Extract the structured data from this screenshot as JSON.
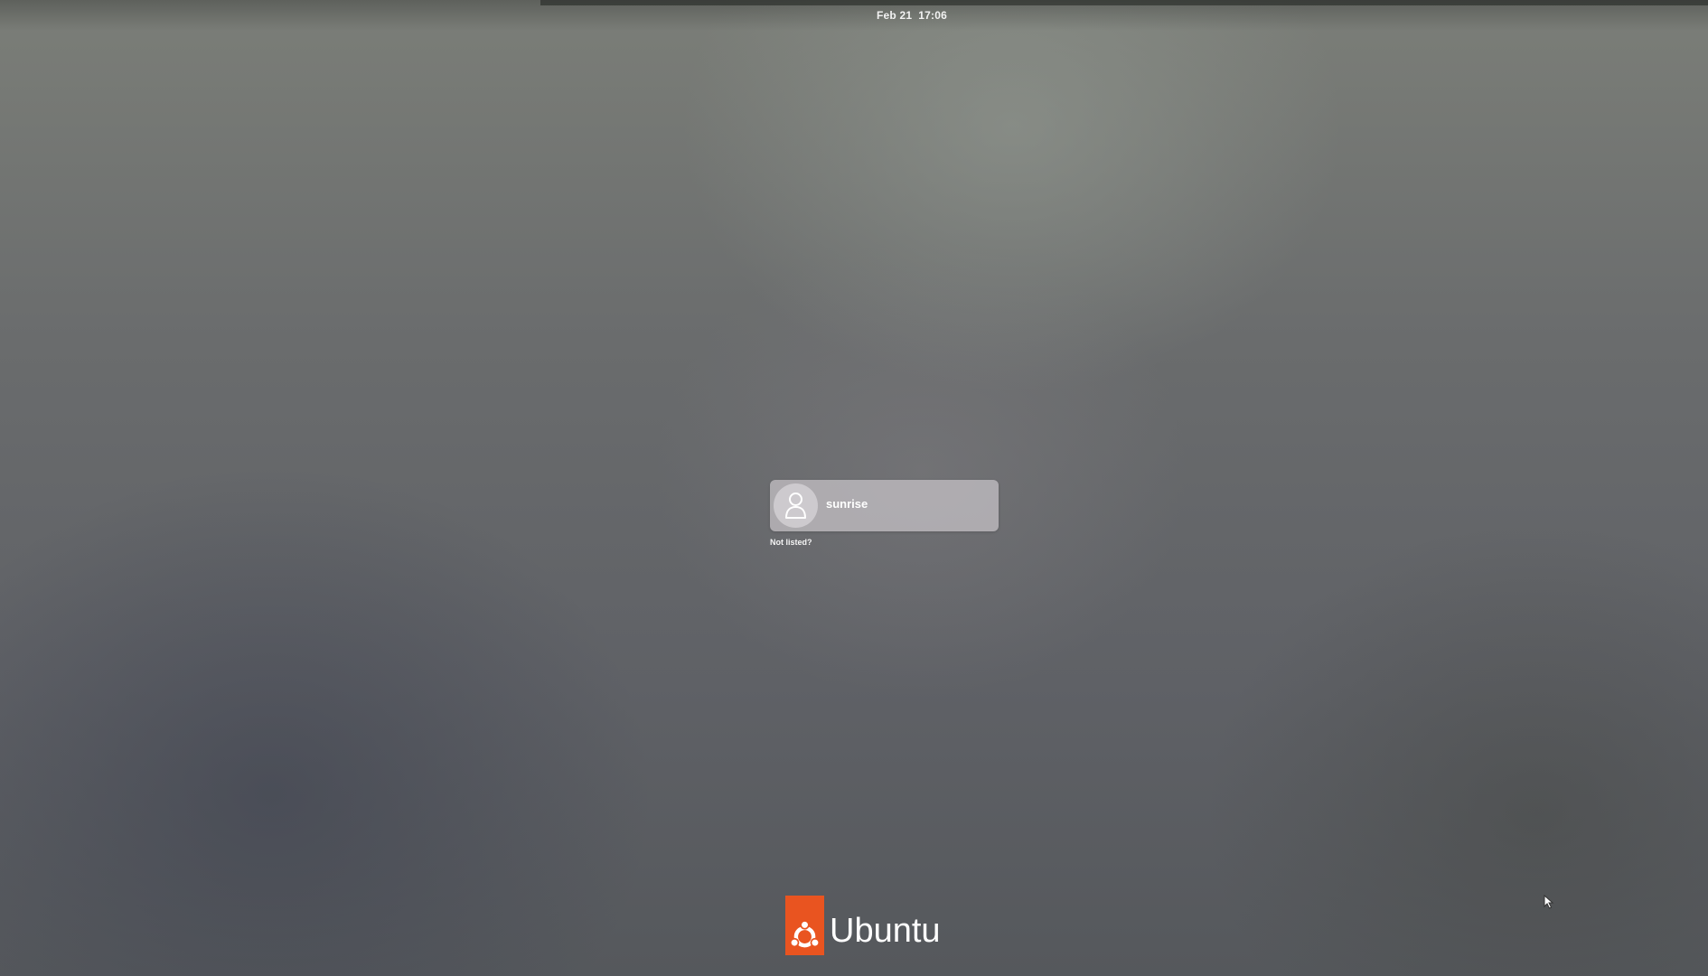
{
  "top_bar": {
    "clock": "Feb 21  17:06"
  },
  "login": {
    "users": [
      {
        "name": "sunrise",
        "avatar_icon": "user-avatar-icon"
      }
    ],
    "not_listed_label": "Not listed?"
  },
  "branding": {
    "text": "Ubuntu",
    "logo_icon": "ubuntu-circle-of-friends-icon",
    "logo_color": "#E95420"
  }
}
